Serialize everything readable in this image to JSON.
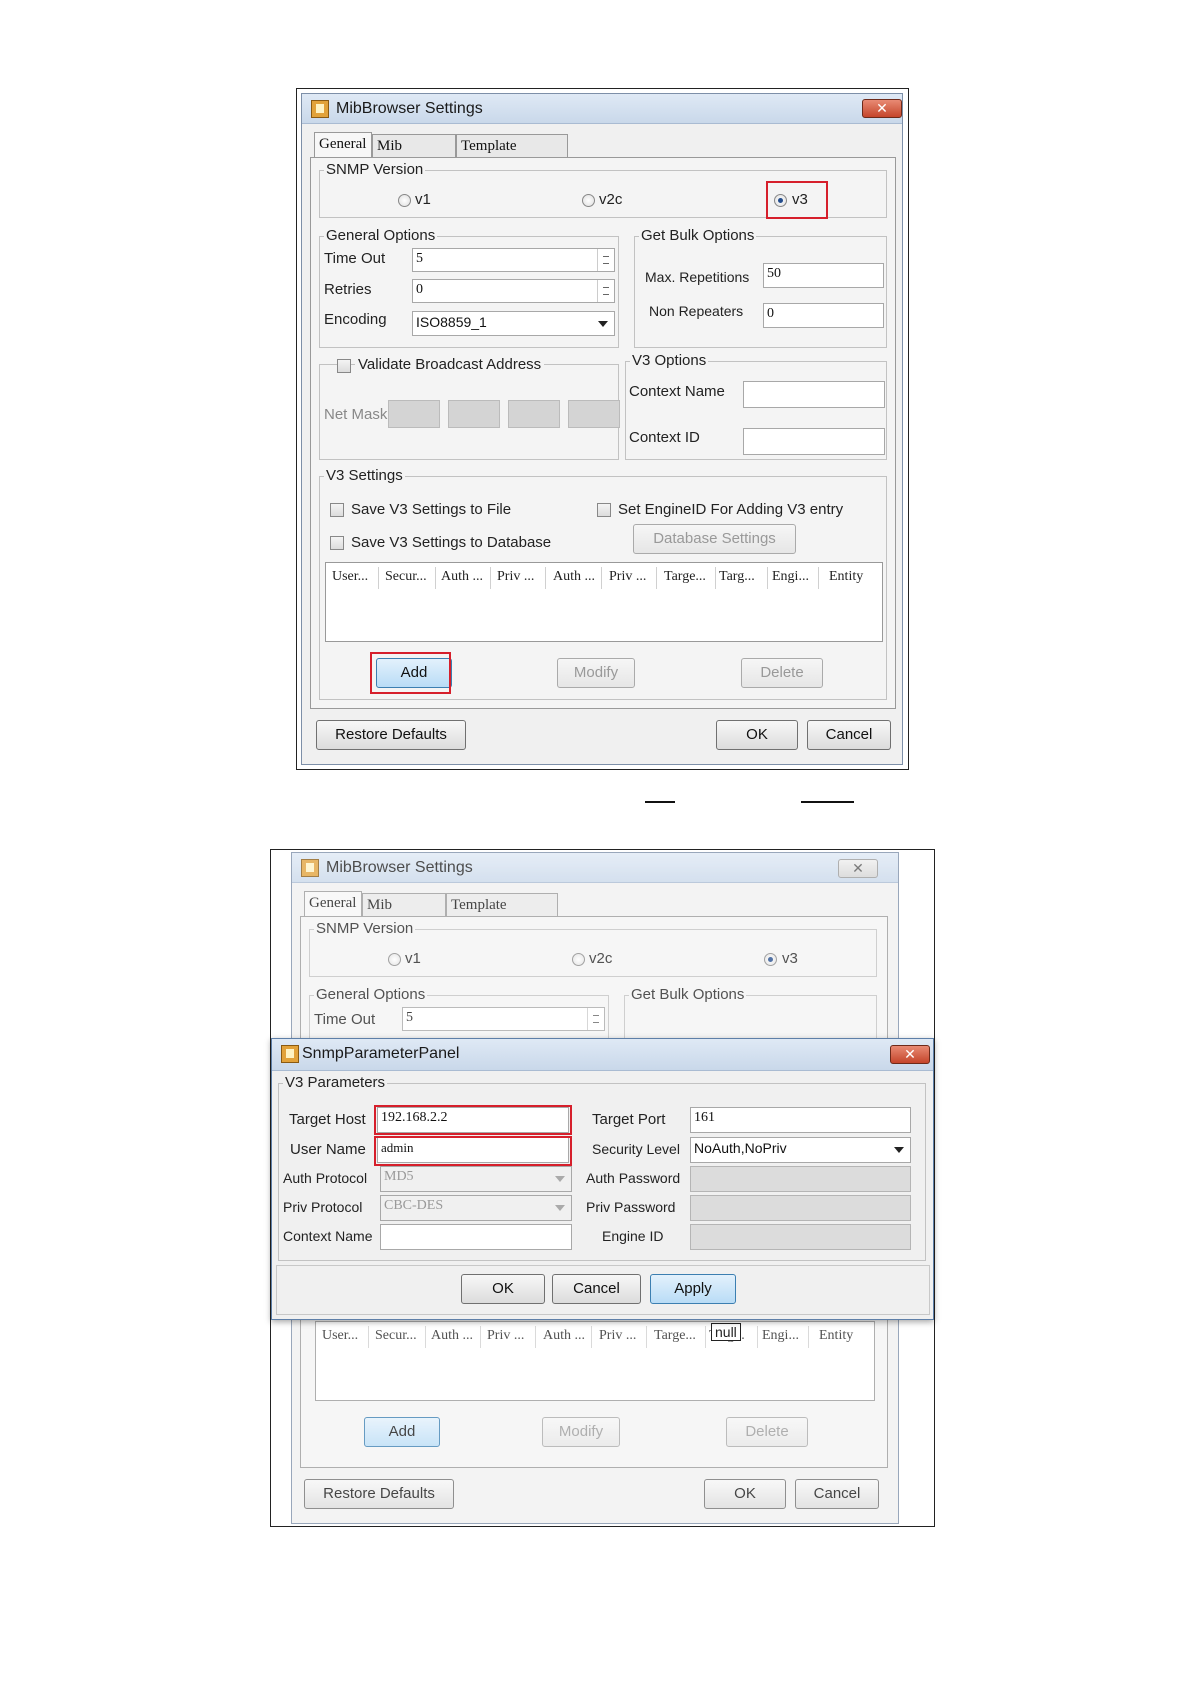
{
  "top_window": {
    "title": "MibBrowser Settings",
    "close_glyph": "✕",
    "tabs": [
      "General",
      "Mib Settings",
      "Template Settings"
    ],
    "snmp_version": {
      "legend": "SNMP Version",
      "options": [
        "v1",
        "v2c",
        "v3"
      ],
      "selected": "v3"
    },
    "general_options": {
      "legend": "General Options",
      "timeout_label": "Time Out",
      "timeout_value": "5",
      "retries_label": "Retries",
      "retries_value": "0",
      "encoding_label": "Encoding",
      "encoding_value": "ISO8859_1"
    },
    "get_bulk": {
      "legend": "Get Bulk Options",
      "max_rep_label": "Max. Repetitions",
      "max_rep_value": "50",
      "non_rep_label": "Non Repeaters",
      "non_rep_value": "0"
    },
    "broadcast": {
      "label": "Validate Broadcast Address",
      "netmask_label": "Net Mask"
    },
    "v3_options": {
      "legend": "V3 Options",
      "context_name_label": "Context Name",
      "context_id_label": "Context ID"
    },
    "v3_settings": {
      "legend": "V3 Settings",
      "save_file_label": "Save V3 Settings to File",
      "save_db_label": "Save V3 Settings to Database",
      "set_engine_label": "Set EngineID For Adding V3 entry",
      "db_settings_label": "Database Settings"
    },
    "table_columns": [
      "User...",
      "Secur...",
      "Auth ...",
      "Priv ...",
      "Auth ...",
      "Priv ...",
      "Targe...",
      "Targ...",
      "Engi...",
      "Entity"
    ],
    "buttons": {
      "add": "Add",
      "modify": "Modify",
      "delete": "Delete",
      "restore": "Restore Defaults",
      "ok": "OK",
      "cancel": "Cancel"
    }
  },
  "bottom_window": {
    "title": "MibBrowser Settings",
    "close_glyph": "✕",
    "tabs": [
      "General",
      "Mib Settings",
      "Template Settings"
    ],
    "snmp_version_legend": "SNMP Version",
    "options": [
      "v1",
      "v2c",
      "v3"
    ],
    "general_options_legend": "General Options",
    "get_bulk_legend": "Get Bulk Options",
    "timeout_label": "Time Out",
    "timeout_value": "5",
    "tooltip": "null",
    "table_columns": [
      "User...",
      "Secur...",
      "Auth ...",
      "Priv ...",
      "Auth ...",
      "Priv ...",
      "Targe...",
      "Targ...",
      "Engi...",
      "Entity"
    ],
    "buttons": {
      "add": "Add",
      "modify": "Modify",
      "delete": "Delete",
      "restore": "Restore Defaults",
      "ok": "OK",
      "cancel": "Cancel"
    }
  },
  "dialog": {
    "title": "SnmpParameterPanel",
    "close_glyph": "✕",
    "legend": "V3 Parameters",
    "target_host_label": "Target Host",
    "target_host_value": "192.168.2.2",
    "target_port_label": "Target Port",
    "target_port_value": "161",
    "user_name_label": "User Name",
    "user_name_value": "admin",
    "security_level_label": "Security Level",
    "security_level_value": "NoAuth,NoPriv",
    "auth_protocol_label": "Auth Protocol",
    "auth_protocol_value": "MD5",
    "auth_password_label": "Auth Password",
    "priv_protocol_label": "Priv Protocol",
    "priv_protocol_value": "CBC-DES",
    "priv_password_label": "Priv Password",
    "context_name_label": "Context Name",
    "engine_id_label": "Engine ID",
    "buttons": {
      "ok": "OK",
      "cancel": "Cancel",
      "apply": "Apply"
    }
  },
  "colors": {
    "highlight": "#d61f2b",
    "selected_button": "#b9dcf6"
  }
}
